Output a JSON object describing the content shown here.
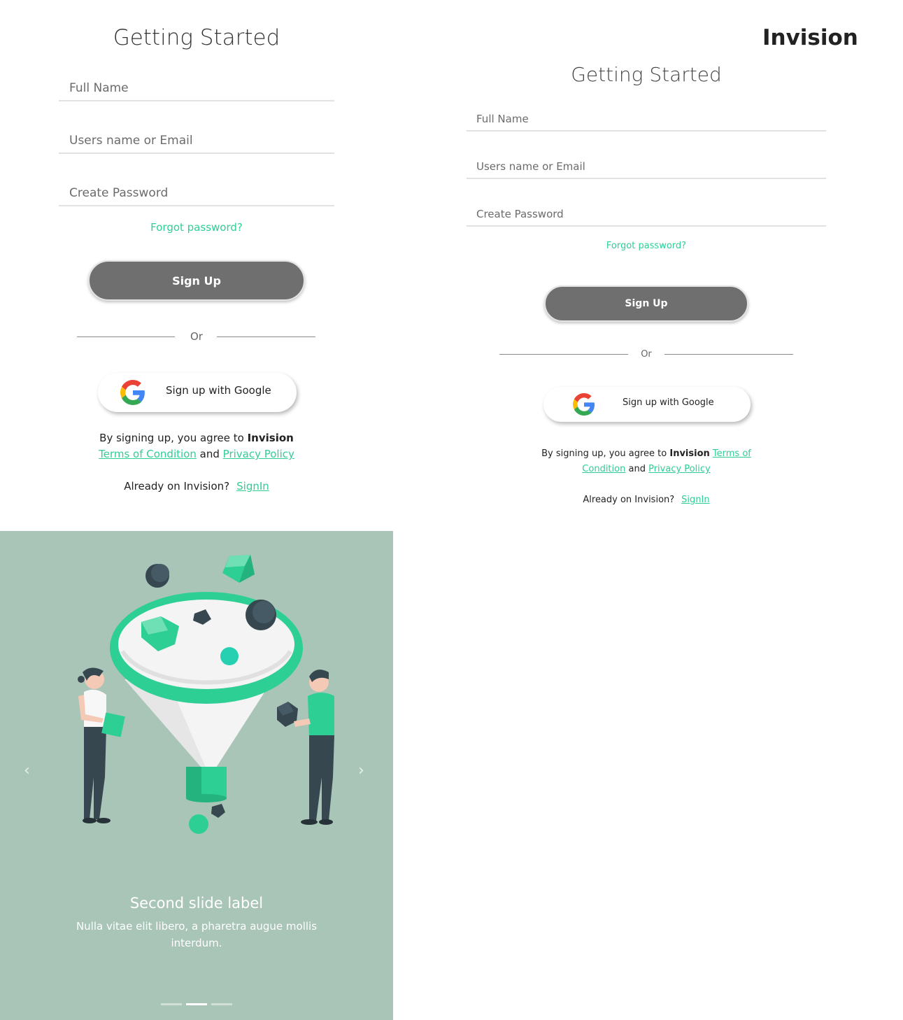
{
  "brand": "Invision",
  "form": {
    "title": "Getting Started",
    "full_name_placeholder": "Full Name",
    "email_placeholder": "Users name or Email",
    "password_placeholder": "Create Password",
    "forgot_password": "Forgot password?",
    "signup_label": "Sign Up",
    "or_label": "Or",
    "google_label": "Sign up with Google",
    "terms_prefix": "By signing up, you agree to",
    "terms_brand": "Invision",
    "terms_link": "Terms of Condition",
    "terms_and": "and",
    "privacy_link": "Privacy Policy",
    "already_text": "Already on Invision?",
    "signin_link": "SignIn"
  },
  "carousel": {
    "slide_label": "Second slide label",
    "slide_text": "Nulla vitae elit libero, a pharetra augue mollis interdum.",
    "prev_icon": "chevron-left-icon",
    "next_icon": "chevron-right-icon",
    "slide_count": 3,
    "active_slide": 2
  },
  "colors": {
    "accent": "#2ecf94",
    "button": "#6f6f6f",
    "carousel_bg": "#a9c5b8"
  }
}
